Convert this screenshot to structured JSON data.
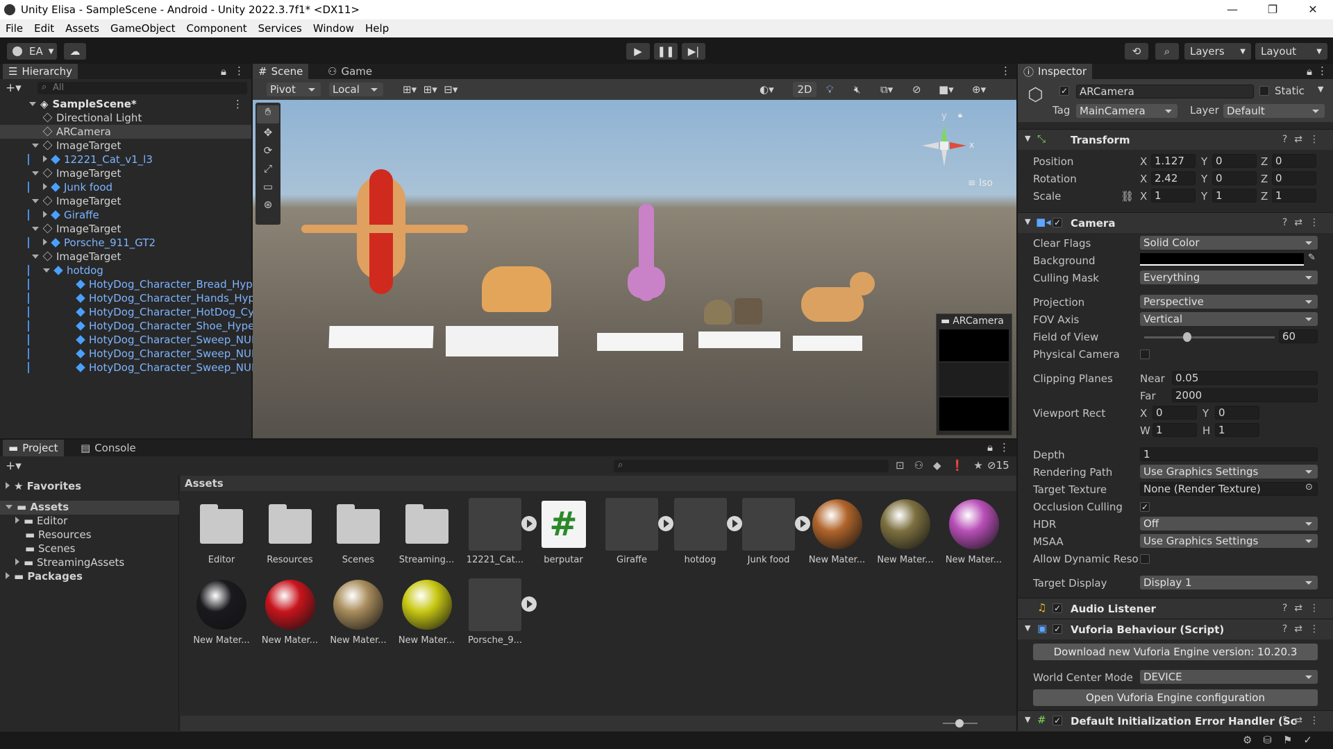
{
  "window": {
    "title": "Unity Elisa - SampleScene - Android - Unity 2022.3.7f1* <DX11>",
    "controls": [
      "—",
      "❐",
      "✕"
    ]
  },
  "menu": [
    "File",
    "Edit",
    "Assets",
    "GameObject",
    "Component",
    "Services",
    "Window",
    "Help"
  ],
  "toolbar": {
    "account": "EA",
    "layers": "Layers",
    "layout": "Layout"
  },
  "hierarchy": {
    "tab": "Hierarchy",
    "search_placeholder": "All",
    "scene": "SampleScene*",
    "items": [
      {
        "label": "Directional Light",
        "indent": 0,
        "prefab": false
      },
      {
        "label": "ARCamera",
        "indent": 0,
        "prefab": false
      },
      {
        "label": "ImageTarget",
        "indent": 0,
        "prefab": false
      },
      {
        "label": "12221_Cat_v1_l3",
        "indent": 1,
        "prefab": true
      },
      {
        "label": "ImageTarget",
        "indent": 0,
        "prefab": false
      },
      {
        "label": "Junk food",
        "indent": 1,
        "prefab": true
      },
      {
        "label": "ImageTarget",
        "indent": 0,
        "prefab": false
      },
      {
        "label": "Giraffe",
        "indent": 1,
        "prefab": true
      },
      {
        "label": "ImageTarget",
        "indent": 0,
        "prefab": false
      },
      {
        "label": "Porsche_911_GT2",
        "indent": 1,
        "prefab": true
      },
      {
        "label": "ImageTarget",
        "indent": 0,
        "prefab": false
      },
      {
        "label": "hotdog",
        "indent": 1,
        "prefab": true
      },
      {
        "label": "HotyDog_Character_Bread_Hype",
        "indent": 2,
        "prefab": true
      },
      {
        "label": "HotyDog_Character_Hands_Hyp",
        "indent": 2,
        "prefab": true
      },
      {
        "label": "HotyDog_Character_HotDog_Cyl",
        "indent": 2,
        "prefab": true
      },
      {
        "label": "HotyDog_Character_Shoe_Hype",
        "indent": 2,
        "prefab": true
      },
      {
        "label": "HotyDog_Character_Sweep_NUF",
        "indent": 2,
        "prefab": true
      },
      {
        "label": "HotyDog_Character_Sweep_NUF",
        "indent": 2,
        "prefab": true
      },
      {
        "label": "HotyDog_Character_Sweep_NUF",
        "indent": 2,
        "prefab": true
      }
    ]
  },
  "scene_view": {
    "tabs": [
      "Scene",
      "Game"
    ],
    "pivot": "Pivot",
    "local": "Local",
    "mode_2d": "2D",
    "gizmo_y": "y",
    "gizmo_x": "x",
    "iso": "Iso",
    "camera_preview_title": "ARCamera"
  },
  "project": {
    "tabs": [
      "Project",
      "Console"
    ],
    "count": "15",
    "favorites": "Favorites",
    "tree": [
      "Assets",
      "Editor",
      "Resources",
      "Scenes",
      "StreamingAssets",
      "Packages"
    ],
    "breadcrumb": "Assets",
    "assets_row1": [
      {
        "label": "Editor",
        "kind": "folder"
      },
      {
        "label": "Resources",
        "kind": "folder"
      },
      {
        "label": "Scenes",
        "kind": "folder"
      },
      {
        "label": "Streaming...",
        "kind": "folder"
      },
      {
        "label": "12221_Cat...",
        "kind": "model"
      },
      {
        "label": "berputar",
        "kind": "script"
      },
      {
        "label": "Giraffe",
        "kind": "model"
      },
      {
        "label": "hotdog",
        "kind": "model"
      },
      {
        "label": "Junk food",
        "kind": "model"
      },
      {
        "label": "New Mater...",
        "kind": "material",
        "color": "#b0642a"
      },
      {
        "label": "New Mater...",
        "kind": "material",
        "color": "#7d7040"
      },
      {
        "label": "New Mater...",
        "kind": "material",
        "color": "#b84fb8"
      }
    ],
    "assets_row2": [
      {
        "label": "New Mater...",
        "kind": "material",
        "color": "#1a1a1e"
      },
      {
        "label": "New Mater...",
        "kind": "material",
        "color": "#c8141c"
      },
      {
        "label": "New Mater...",
        "kind": "material",
        "color": "#a88c5c"
      },
      {
        "label": "New Mater...",
        "kind": "material",
        "color": "#c8c814"
      },
      {
        "label": "Porsche_9...",
        "kind": "model"
      }
    ]
  },
  "inspector": {
    "tab": "Inspector",
    "object_name": "ARCamera",
    "static_label": "Static",
    "tag_label": "Tag",
    "tag_value": "MainCamera",
    "layer_label": "Layer",
    "layer_value": "Default",
    "transform": {
      "title": "Transform",
      "position_label": "Position",
      "rotation_label": "Rotation",
      "scale_label": "Scale",
      "position": [
        "1.127",
        "0",
        "0"
      ],
      "rotation": [
        "2.42",
        "0",
        "0"
      ],
      "scale": [
        "1",
        "1",
        "1"
      ]
    },
    "camera": {
      "title": "Camera",
      "clear_flags_label": "Clear Flags",
      "clear_flags": "Solid Color",
      "background_label": "Background",
      "culling_mask_label": "Culling Mask",
      "culling_mask": "Everything",
      "projection_label": "Projection",
      "projection": "Perspective",
      "fov_axis_label": "FOV Axis",
      "fov_axis": "Vertical",
      "fov_label": "Field of View",
      "fov_value": "60",
      "fov_fraction": 0.33,
      "physical_label": "Physical Camera",
      "clipping_label": "Clipping Planes",
      "near_label": "Near",
      "near": "0.05",
      "far_label": "Far",
      "far": "2000",
      "viewport_label": "Viewport Rect",
      "vp_x": "0",
      "vp_y": "0",
      "vp_w": "1",
      "vp_h": "1",
      "depth_label": "Depth",
      "depth": "1",
      "rendering_path_label": "Rendering Path",
      "rendering_path": "Use Graphics Settings",
      "target_texture_label": "Target Texture",
      "target_texture": "None (Render Texture)",
      "occlusion_label": "Occlusion Culling",
      "hdr_label": "HDR",
      "hdr": "Off",
      "msaa_label": "MSAA",
      "msaa": "Use Graphics Settings",
      "dyn_res_label": "Allow Dynamic Reso",
      "target_display_label": "Target Display",
      "target_display": "Display 1"
    },
    "audio_listener": "Audio Listener",
    "vuforia": {
      "title": "Vuforia Behaviour (Script)",
      "download_button": "Download new Vuforia Engine version: 10.20.3",
      "world_center_label": "World Center Mode",
      "world_center": "DEVICE",
      "open_config_button": "Open Vuforia Engine configuration"
    },
    "default_init": "Default Initialization Error Handler (Sc"
  }
}
